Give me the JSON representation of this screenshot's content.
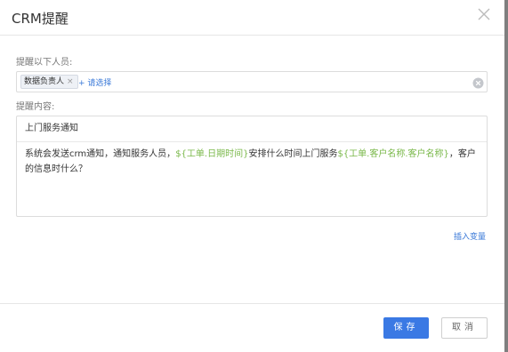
{
  "dialog": {
    "title": "CRM提醒"
  },
  "recipients": {
    "label": "提醒以下人员:",
    "tags": [
      {
        "label": "数据负责人"
      }
    ],
    "add_label": "+ 请选择"
  },
  "content": {
    "label": "提醒内容:",
    "subject": "上门服务通知",
    "body_parts": [
      {
        "text": "系统会发送crm通知，通知服务人员，"
      },
      {
        "text": "${工单.日期时间}"
      },
      {
        "text": "安排什么时间上门服务"
      },
      {
        "text": "${工单.客户名称.客户名称}"
      },
      {
        "text": "，客户的信息时什么？"
      }
    ]
  },
  "insert_variable": "插入变量",
  "footer": {
    "save_label": "保存",
    "cancel_label": "取消"
  },
  "colors": {
    "accent": "#3a79e4",
    "variable": "#7ab84a"
  }
}
